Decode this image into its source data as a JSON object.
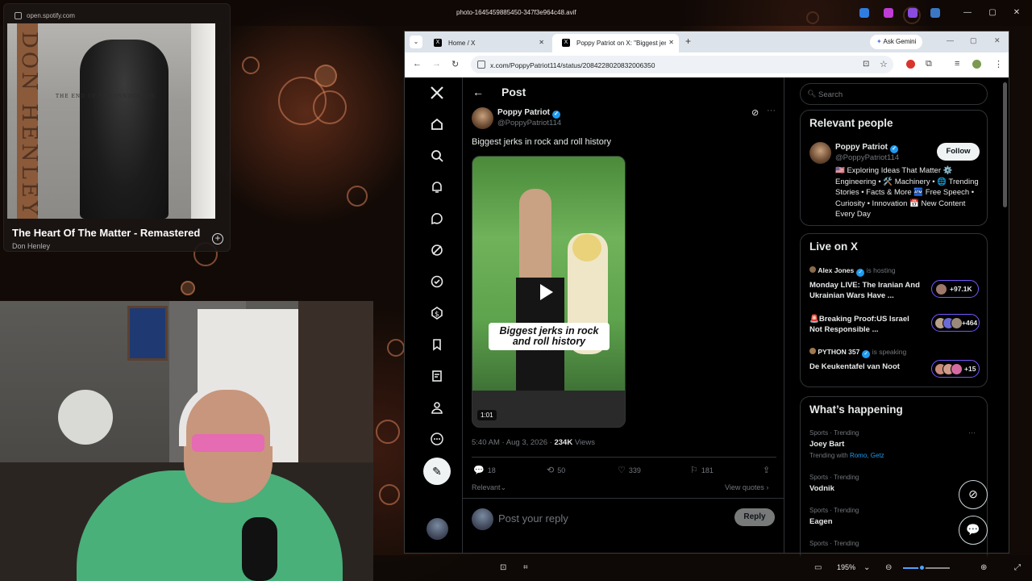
{
  "viewer": {
    "title": "photo-1645459885450-347f3e964c48.avif",
    "zoom": "195%"
  },
  "spotify": {
    "url": "open.spotify.com",
    "album_artist_text": "DON HENLEY",
    "album_subtitle": "THE END OF THE INNOCENCE",
    "track_title": "The Heart Of The Matter - Remastered",
    "artist": "Don Henley",
    "add_label": "+"
  },
  "browser": {
    "tabs": [
      {
        "label": "Home / X"
      },
      {
        "label": "Poppy Patriot on X: \"Biggest jerk"
      }
    ],
    "new_tab": "+",
    "ask_gemini": "Ask Gemini",
    "url": "x.com/PoppyPatriot114/status/2084228020832006350"
  },
  "x": {
    "page_heading": "Post",
    "post": {
      "author": "Poppy Patriot",
      "handle": "@PoppyPatriot114",
      "text": "Biggest jerks in rock and roll history",
      "video_caption": "Biggest jerks in rock and roll history",
      "video_duration": "1:01",
      "time": "5:40 AM · Aug 3, 2026 · ",
      "views_count": "234K",
      "views_label": " Views",
      "replies": "18",
      "reposts": "50",
      "likes": "339",
      "bookmarks": "181",
      "sort_label": "Relevant",
      "view_quotes": "View quotes"
    },
    "reply": {
      "placeholder": "Post your reply",
      "button": "Reply"
    },
    "search_placeholder": "Search",
    "relevant_people": {
      "title": "Relevant people",
      "name": "Poppy Patriot",
      "handle": "@PoppyPatriot114",
      "follow": "Follow",
      "bio": "🇺🇸 Exploring Ideas That Matter ⚙️ Engineering • 🛠️ Machinery • 🌐 Trending Stories • Facts & More 🏧 Free Speech • Curiosity • Innovation 📅 New Content Every Day"
    },
    "live": {
      "title": "Live on X",
      "items": [
        {
          "host": "Alex Jones",
          "status": "is hosting",
          "title": "Monday LIVE: The Iranian And Ukrainian Wars Have ...",
          "count": "+97.1K"
        },
        {
          "host": "",
          "status": "",
          "title": "🚨Breaking Proof:US Israel Not Responsible ...",
          "count": "+464"
        },
        {
          "host": "PYTHON 357",
          "status": "is speaking",
          "title": "De Keukentafel van Noot",
          "count": "+15"
        }
      ]
    },
    "trending": {
      "title": "What’s happening",
      "items": [
        {
          "category": "Sports · Trending",
          "name": "Joey Bart"
        },
        {
          "category": "Sports · Trending",
          "name": "Vodnik"
        },
        {
          "category": "Sports · Trending",
          "name": "Eagen"
        },
        {
          "category": "Sports · Trending",
          "name": ""
        }
      ],
      "trending_with_label": "Trending with ",
      "trending_with_names": "Romo, Getz"
    }
  },
  "colors": {
    "x_blue": "#1d9bf0",
    "x_text": "#e7e9ea",
    "x_muted": "#71767b",
    "live_purple": "#7856ff"
  }
}
